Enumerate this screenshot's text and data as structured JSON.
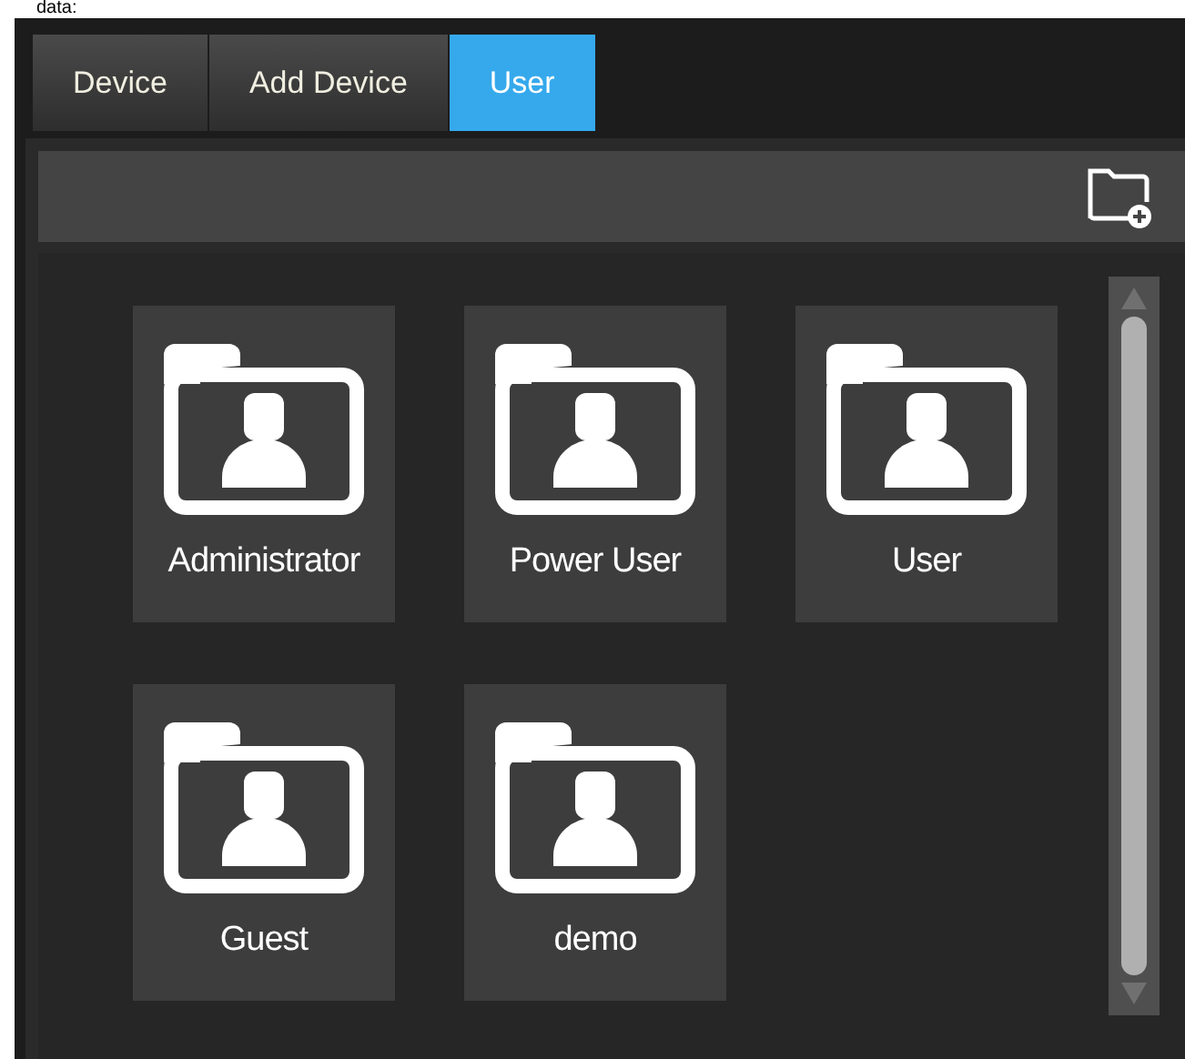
{
  "caption": "data:",
  "tabs": [
    {
      "label": "Device",
      "selected": false
    },
    {
      "label": "Add Device",
      "selected": false
    },
    {
      "label": "User",
      "selected": true
    }
  ],
  "groups": [
    {
      "label": "Administrator"
    },
    {
      "label": "Power User"
    },
    {
      "label": "User"
    },
    {
      "label": "Guest"
    },
    {
      "label": "demo"
    }
  ]
}
